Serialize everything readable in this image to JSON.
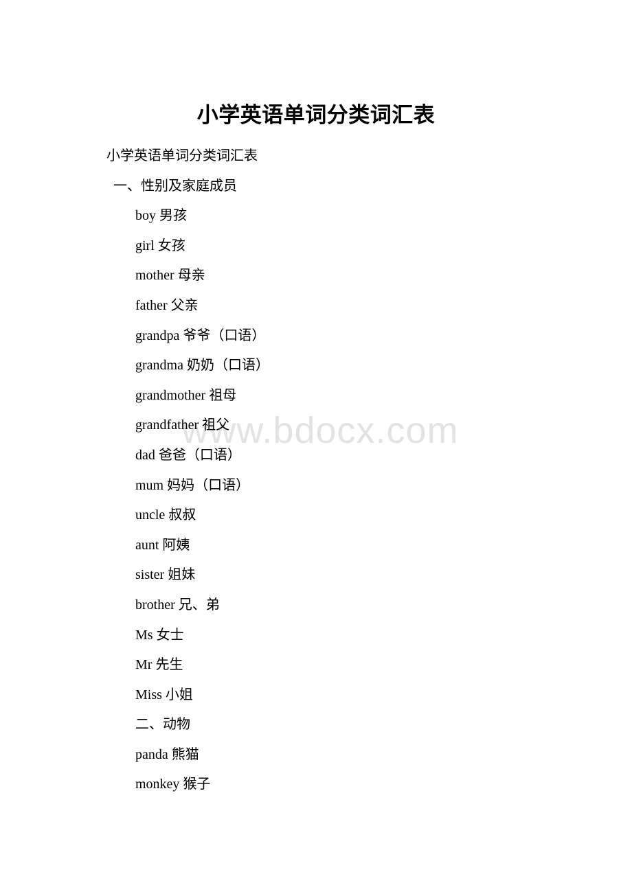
{
  "document": {
    "title": "小学英语单词分类词汇表",
    "watermark": "www.bdocx.com",
    "lines": [
      {
        "text": "小学英语单词分类词汇表",
        "level": 0
      },
      {
        "text": " 一、性别及家庭成员",
        "level": 1
      },
      {
        "text": "boy 男孩",
        "level": 2
      },
      {
        "text": "girl 女孩",
        "level": 2
      },
      {
        "text": "mother 母亲",
        "level": 2
      },
      {
        "text": "father 父亲",
        "level": 2
      },
      {
        "text": "grandpa 爷爷（口语）",
        "level": 2
      },
      {
        "text": "grandma 奶奶（口语）",
        "level": 2
      },
      {
        "text": "grandmother 祖母",
        "level": 2
      },
      {
        "text": "grandfather 祖父",
        "level": 2
      },
      {
        "text": "dad 爸爸（口语）",
        "level": 2
      },
      {
        "text": "mum 妈妈（口语）",
        "level": 2
      },
      {
        "text": "uncle 叔叔",
        "level": 2
      },
      {
        "text": "aunt 阿姨",
        "level": 2
      },
      {
        "text": "sister 姐妹",
        "level": 2
      },
      {
        "text": "brother 兄、弟",
        "level": 2
      },
      {
        "text": "Ms 女士",
        "level": 2
      },
      {
        "text": "Mr 先生",
        "level": 2
      },
      {
        "text": "Miss 小姐",
        "level": 2
      },
      {
        "text": "二、动物",
        "level": 2
      },
      {
        "text": "panda 熊猫",
        "level": 2
      },
      {
        "text": "monkey 猴子",
        "level": 2
      }
    ]
  },
  "colors": {
    "text": "#000000",
    "watermark": "#e3e3e3",
    "background": "#ffffff"
  }
}
